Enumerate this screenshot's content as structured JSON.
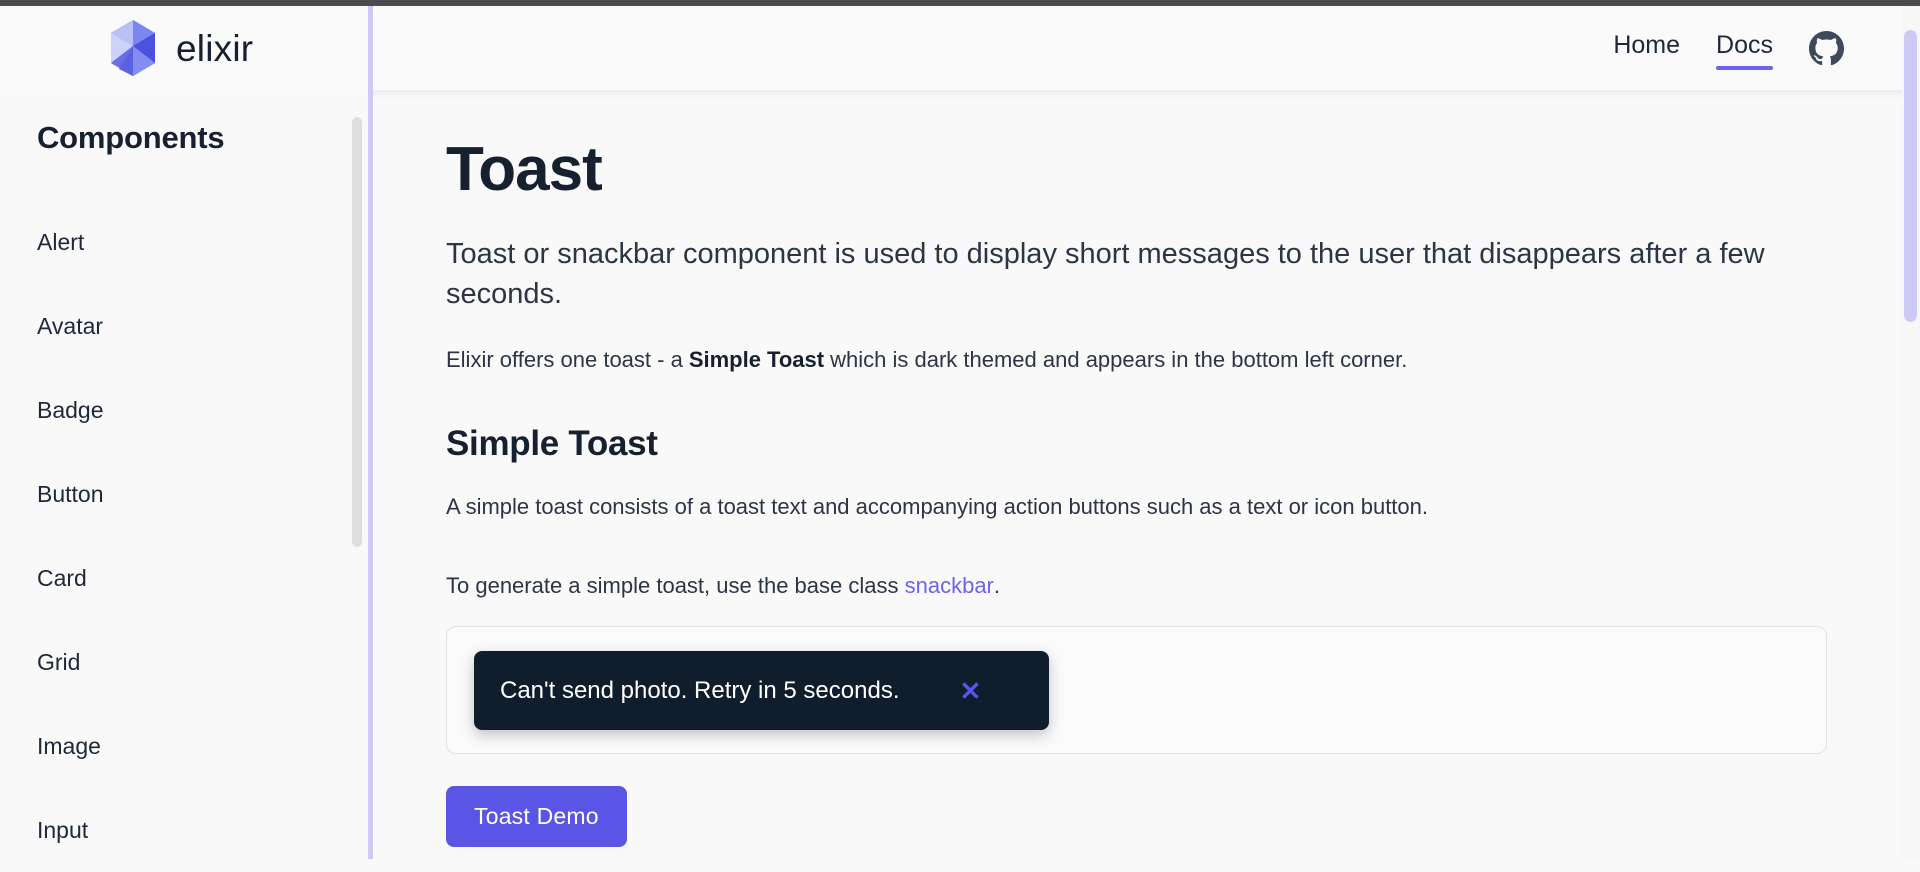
{
  "brand": {
    "name": "elixir",
    "logo_icon": "gem-logo-icon"
  },
  "topnav": {
    "links": [
      {
        "label": "Home",
        "active": false
      },
      {
        "label": "Docs",
        "active": true
      }
    ],
    "github_icon": "github-icon"
  },
  "sidebar": {
    "title": "Components",
    "items": [
      {
        "label": "Alert"
      },
      {
        "label": "Avatar"
      },
      {
        "label": "Badge"
      },
      {
        "label": "Button"
      },
      {
        "label": "Card"
      },
      {
        "label": "Grid"
      },
      {
        "label": "Image"
      },
      {
        "label": "Input"
      }
    ]
  },
  "doc": {
    "title": "Toast",
    "lead": "Toast or snackbar component is used to display short messages to the user that disappears after a few seconds.",
    "intro_prefix": "Elixir offers one toast - a",
    "intro_strong": "Simple Toast",
    "intro_suffix": "which is dark themed and appears in the bottom left corner.",
    "section_title": "Simple Toast",
    "section_body": "A simple toast consists of a toast text and accompanying action buttons such as a text or icon button.",
    "usage_prefix": "To generate a simple toast, use the base class",
    "usage_link": "snackbar",
    "usage_suffix": ".",
    "demo": {
      "toast_message": "Can't send photo. Retry in 5 seconds.",
      "toast_close_icon": "close-icon",
      "toast_close_glyph": "✕",
      "button_label": "Toast Demo"
    }
  },
  "colors": {
    "accent_purple": "#5b55e6",
    "link_purple": "#6c63f0",
    "toast_background": "#101d2c",
    "scrollbar_purple": "#cdcbf6",
    "divider_purple": "#cdcbf6",
    "text_dark": "#16202e",
    "page_background": "#f9f9fa"
  }
}
